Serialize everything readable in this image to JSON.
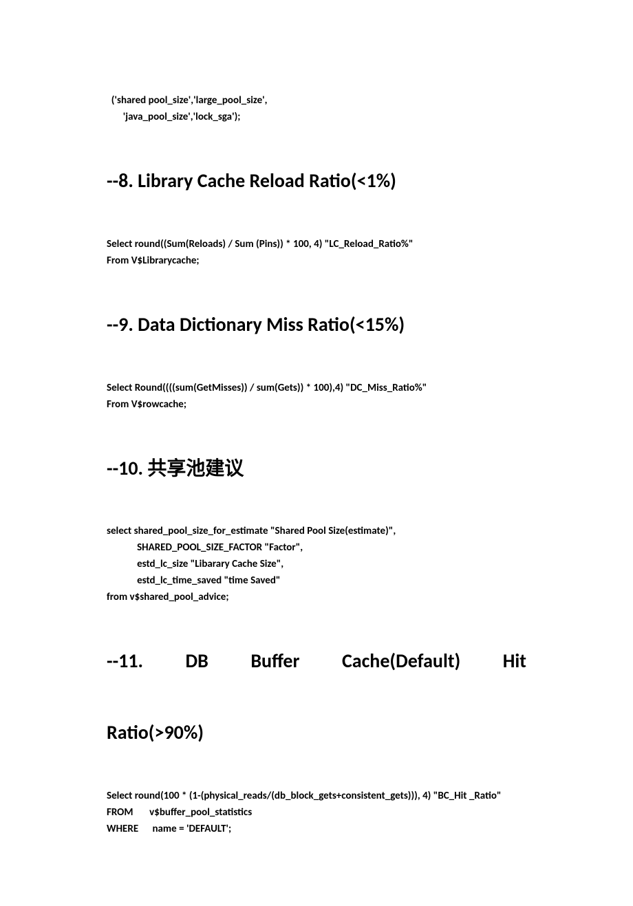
{
  "preamble": {
    "line1": "('shared pool_size','large_pool_size',",
    "line2": "       'java_pool_size','lock_sga');"
  },
  "sections": [
    {
      "heading": "--8. Library Cache Reload Ratio(<1%)",
      "lines": [
        "Select round((Sum(Reloads) / Sum (Pins)) * 100, 4) \"LC_Reload_Ratio%\"",
        "From V$Librarycache;"
      ]
    },
    {
      "heading": "--9. Data Dictionary Miss Ratio(<15%)",
      "lines": [
        "Select Round((((sum(GetMisses)) / sum(Gets)) * 100),4) \"DC_Miss_Ratio%\"",
        "From V$rowcache;"
      ]
    },
    {
      "heading": "--10.  共享池建议",
      "lines": [
        "select shared_pool_size_for_estimate \"Shared Pool Size(estimate)\",",
        "             SHARED_POOL_SIZE_FACTOR \"Factor\",",
        "             estd_lc_size \"Libarary Cache Size\",",
        "             estd_lc_time_saved \"time Saved\"",
        "from v$shared_pool_advice;"
      ]
    },
    {
      "heading_line1": "--11.   DB   Buffer   Cache(Default)   Hit",
      "heading_line2": "Ratio(>90%)",
      "lines": [
        "Select round(100 * (1-(physical_reads/(db_block_gets+consistent_gets))), 4) \"BC_Hit _Ratio\"",
        "FROM       v$buffer_pool_statistics",
        "WHERE      name = 'DEFAULT';"
      ]
    }
  ]
}
